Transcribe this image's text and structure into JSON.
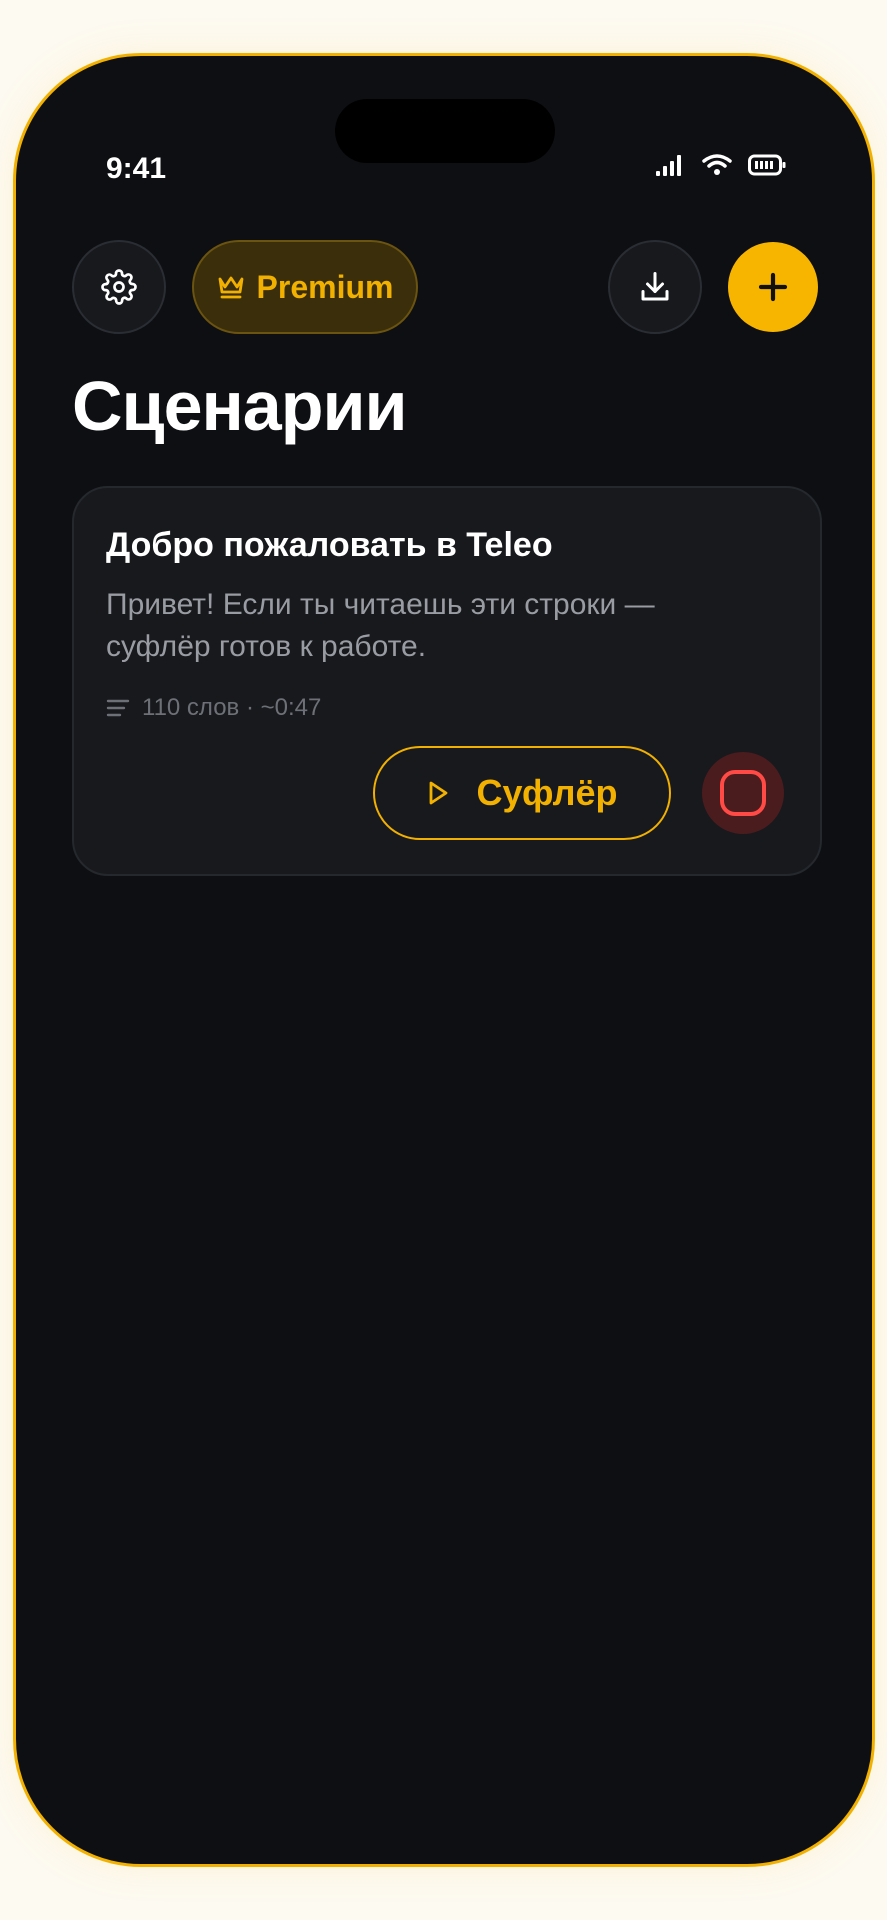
{
  "status_bar": {
    "time": "9:41"
  },
  "header": {
    "premium_label": "Premium",
    "title": "Сценарии"
  },
  "scripts": [
    {
      "title": "Добро пожаловать в Teleo",
      "preview": "Привет! Если ты читаешь эти строки — суфлёр готов к работе.",
      "meta": "110 слов · ~0:47",
      "prompter_label": "Суфлёр"
    }
  ],
  "colors": {
    "accent": "#f2b100",
    "background": "#0e0f12",
    "card": "#17191d",
    "record": "#ff4a45"
  },
  "icons": [
    "gear-icon",
    "crown-icon",
    "download-icon",
    "plus-icon",
    "lines-icon",
    "play-icon",
    "record-icon",
    "signal-icon",
    "wifi-icon",
    "battery-icon"
  ]
}
